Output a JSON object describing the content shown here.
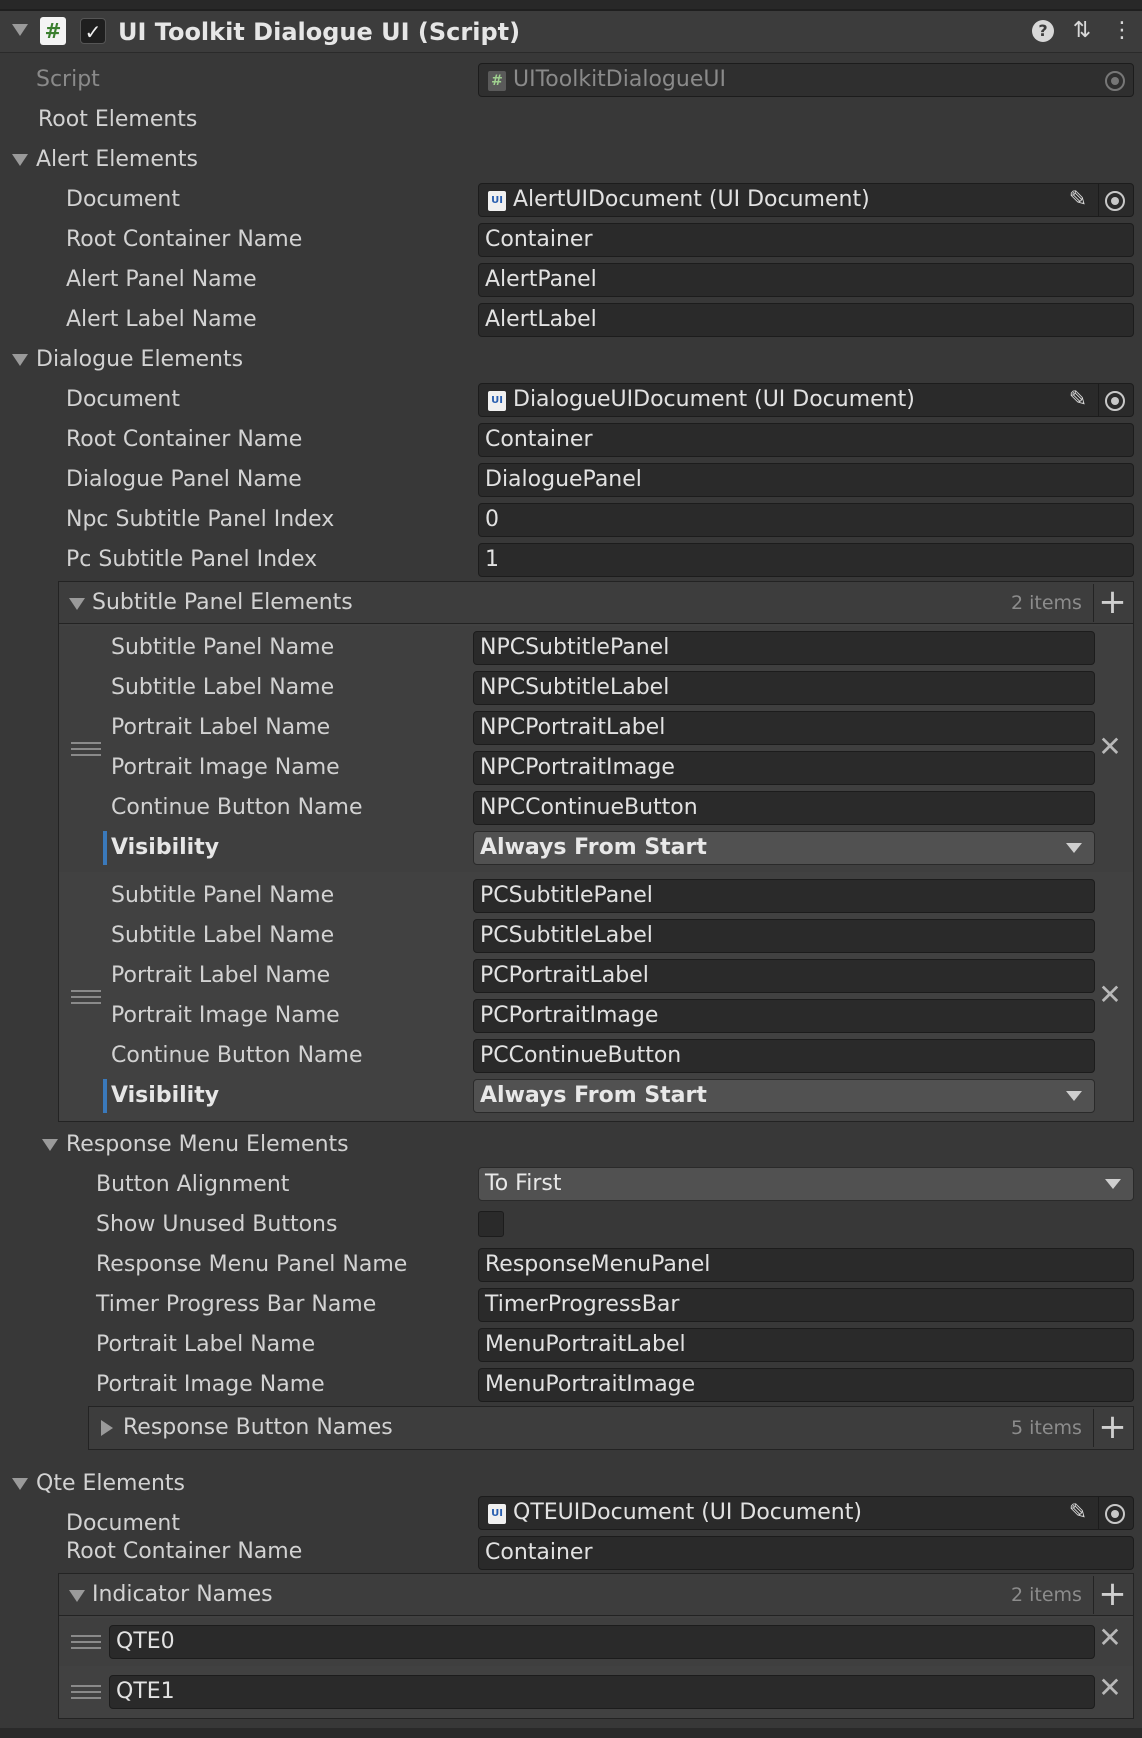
{
  "header": {
    "title": "UI Toolkit Dialogue UI (Script)",
    "script_icon_glyph": "#",
    "enabled_check": "✓",
    "menu_glyph": "⋮",
    "settings_glyph": "⇅"
  },
  "script": {
    "label": "Script",
    "value": "UIToolkitDialogueUI"
  },
  "root_elements": {
    "label": "Root Elements"
  },
  "alert": {
    "label": "Alert Elements",
    "document_label": "Document",
    "document_value": "AlertUIDocument (UI Document)",
    "root_container_label": "Root Container Name",
    "root_container_value": "Container",
    "panel_label": "Alert Panel Name",
    "panel_value": "AlertPanel",
    "label_label": "Alert Label Name",
    "label_value": "AlertLabel"
  },
  "dialogue": {
    "label": "Dialogue Elements",
    "document_label": "Document",
    "document_value": "DialogueUIDocument (UI Document)",
    "root_container_label": "Root Container Name",
    "root_container_value": "Container",
    "panel_label": "Dialogue Panel Name",
    "panel_value": "DialoguePanel",
    "npc_index_label": "Npc Subtitle Panel Index",
    "npc_index_value": "0",
    "pc_index_label": "Pc Subtitle Panel Index",
    "pc_index_value": "1",
    "subtitle_list": {
      "label": "Subtitle Panel Elements",
      "count": "2 items",
      "items": [
        {
          "subtitle_panel_label": "Subtitle Panel Name",
          "subtitle_panel_value": "NPCSubtitlePanel",
          "subtitle_label_label": "Subtitle Label Name",
          "subtitle_label_value": "NPCSubtitleLabel",
          "portrait_label_label": "Portrait Label Name",
          "portrait_label_value": "NPCPortraitLabel",
          "portrait_image_label": "Portrait Image Name",
          "portrait_image_value": "NPCPortraitImage",
          "continue_label": "Continue Button Name",
          "continue_value": "NPCContinueButton",
          "visibility_label": "Visibility",
          "visibility_value": "Always From Start"
        },
        {
          "subtitle_panel_label": "Subtitle Panel Name",
          "subtitle_panel_value": "PCSubtitlePanel",
          "subtitle_label_label": "Subtitle Label Name",
          "subtitle_label_value": "PCSubtitleLabel",
          "portrait_label_label": "Portrait Label Name",
          "portrait_label_value": "PCPortraitLabel",
          "portrait_image_label": "Portrait Image Name",
          "portrait_image_value": "PCPortraitImage",
          "continue_label": "Continue Button Name",
          "continue_value": "PCContinueButton",
          "visibility_label": "Visibility",
          "visibility_value": "Always From Start"
        }
      ]
    }
  },
  "response": {
    "label": "Response Menu Elements",
    "alignment_label": "Button Alignment",
    "alignment_value": "To First",
    "unused_label": "Show Unused Buttons",
    "panel_label": "Response Menu Panel Name",
    "panel_value": "ResponseMenuPanel",
    "timer_label": "Timer Progress Bar Name",
    "timer_value": "TimerProgressBar",
    "portrait_label_label": "Portrait Label Name",
    "portrait_label_value": "MenuPortraitLabel",
    "portrait_image_label": "Portrait Image Name",
    "portrait_image_value": "MenuPortraitImage",
    "buttons_list": {
      "label": "Response Button Names",
      "count": "5 items"
    }
  },
  "qte": {
    "label": "Qte Elements",
    "document_label": "Document",
    "document_value": "QTEUIDocument (UI Document)",
    "root_container_label": "Root Container Name",
    "root_container_value": "Container",
    "indicator_list": {
      "label": "Indicator Names",
      "count": "2 items",
      "items": [
        "QTE0",
        "QTE1"
      ]
    }
  },
  "icons": {
    "remove": "✕",
    "add": "+",
    "pencil": "✎",
    "help": "?"
  }
}
